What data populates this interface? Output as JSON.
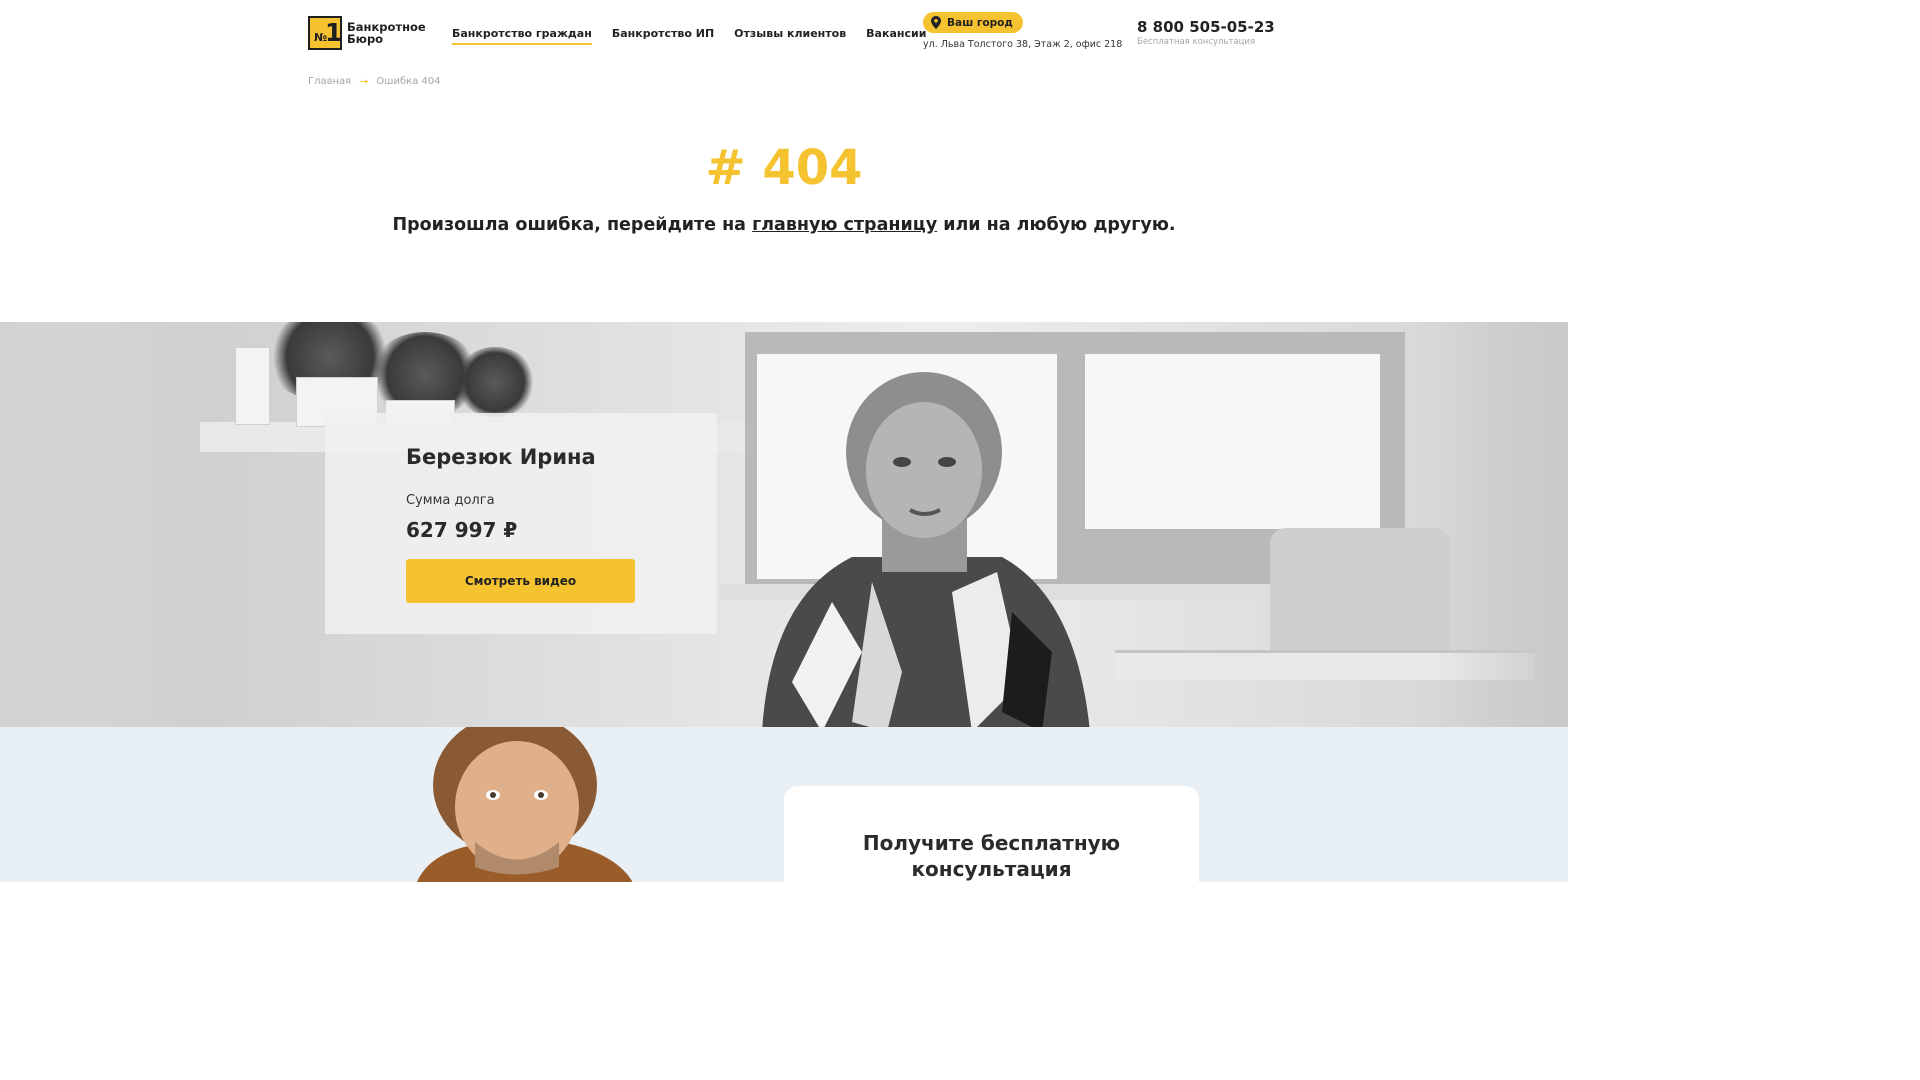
{
  "header": {
    "logo": {
      "mark_number": "1",
      "mark_prefix": "№",
      "line1": "Банкротное",
      "line2": "Бюро"
    },
    "nav": [
      {
        "label": "Банкротство граждан",
        "active": true
      },
      {
        "label": "Банкротство ИП",
        "active": false
      },
      {
        "label": "Отзывы клиентов",
        "active": false
      },
      {
        "label": "Вакансии",
        "active": false
      }
    ],
    "city_button": {
      "label": "Ваш город",
      "icon": "map-pin-icon"
    },
    "address": "ул. Льва Толстого 38, Этаж 2, офис 218",
    "phone": "8 800 505-05-23",
    "phone_caption": "Бесплатная консультация"
  },
  "breadcrumb": {
    "home": "Главная",
    "separator": "→",
    "current": "Ошибка 404"
  },
  "error": {
    "code": "# 404",
    "text_before": "Произошла ошибка, перейдите на ",
    "link": "главную страницу",
    "text_after": " или на любую другую."
  },
  "review": {
    "name": "Березюк Ирина",
    "debt_label": "Сумма долга",
    "debt_value": "627 997 ₽",
    "button": "Смотреть видео"
  },
  "consultation": {
    "title_line1": "Получите бесплатную",
    "title_line2": "консультация"
  },
  "colors": {
    "accent": "#f5c230",
    "text": "#222222",
    "muted": "#a5a5a5",
    "section_bg": "#e8f0f6"
  }
}
